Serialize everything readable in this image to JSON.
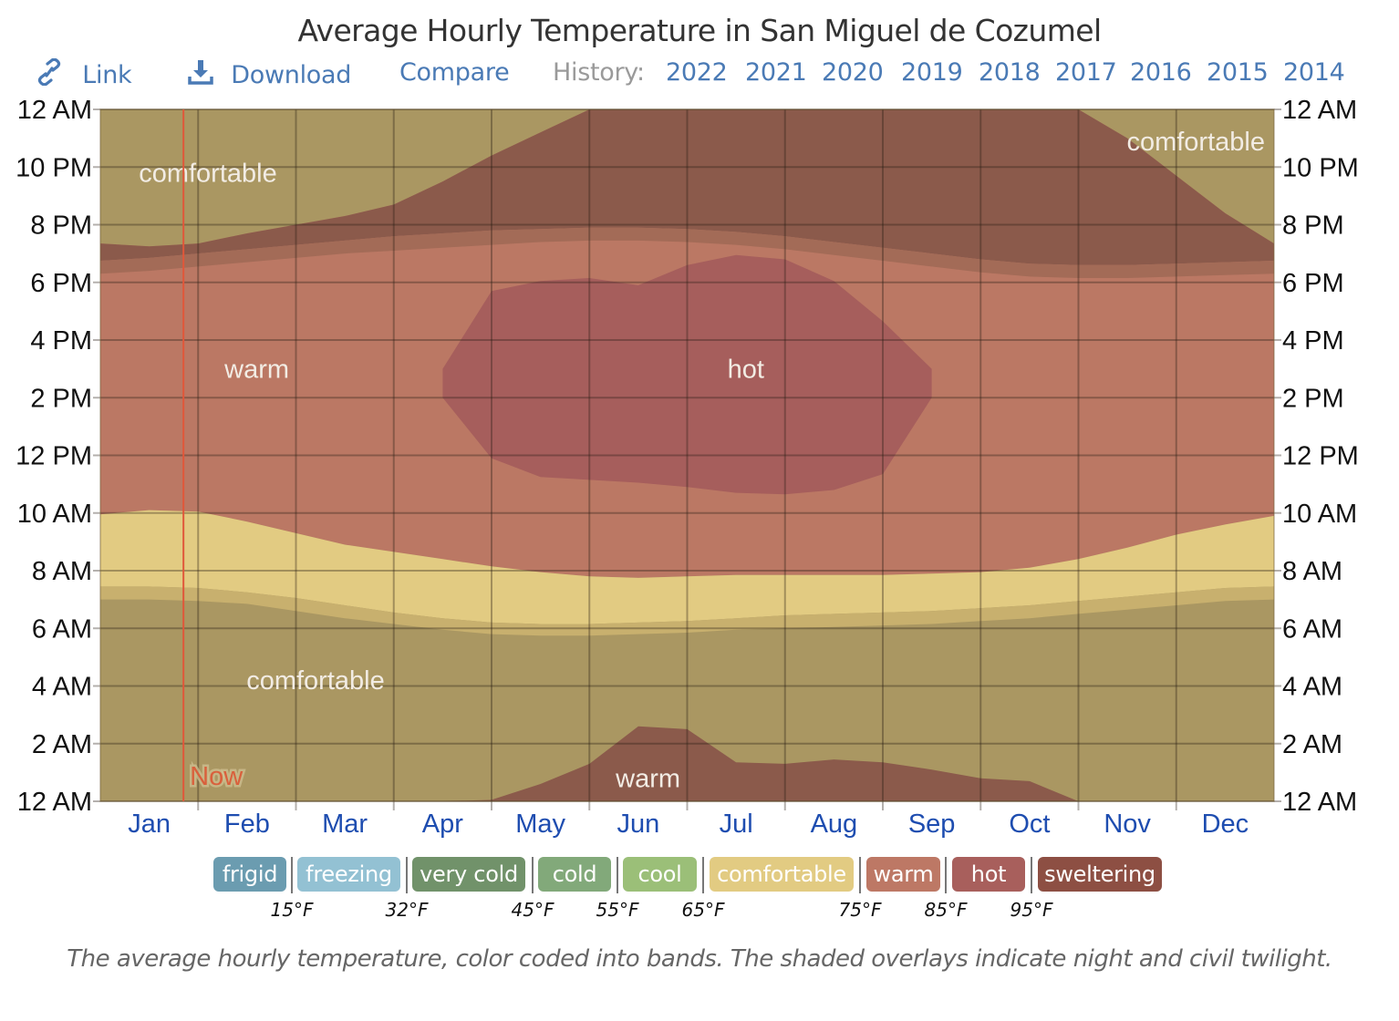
{
  "header": {
    "title": "Average Hourly Temperature in San Miguel de Cozumel"
  },
  "toolbar": {
    "link_label": "Link",
    "link_icon": "link-icon",
    "download_label": "Download",
    "download_icon": "download-icon",
    "compare_label": "Compare",
    "history_label": "History:",
    "history_years": [
      "2022",
      "2021",
      "2020",
      "2019",
      "2018",
      "2017",
      "2016",
      "2015",
      "2014"
    ]
  },
  "legend": {
    "bands": [
      {
        "label": "frigid",
        "color": "#6b9cb0"
      },
      {
        "label": "freezing",
        "color": "#93c1d3"
      },
      {
        "label": "very cold",
        "color": "#71926a"
      },
      {
        "label": "cold",
        "color": "#82a97a"
      },
      {
        "label": "cool",
        "color": "#9bbf78"
      },
      {
        "label": "comfortable",
        "color": "#e2cb82"
      },
      {
        "label": "warm",
        "color": "#bd7865"
      },
      {
        "label": "hot",
        "color": "#a85f5c"
      },
      {
        "label": "sweltering",
        "color": "#8d4f43"
      }
    ],
    "thresholds": [
      "15°F",
      "32°F",
      "45°F",
      "55°F",
      "65°F",
      "75°F",
      "85°F",
      "95°F"
    ]
  },
  "caption": "The average hourly temperature, color coded into bands. The shaded overlays indicate night and civil twilight.",
  "now_label": "Now",
  "chart_data": {
    "type": "heatmap",
    "title": "Average Hourly Temperature in San Miguel de Cozumel",
    "xlabel": "",
    "ylabel": "",
    "x_tick_labels": [
      "Jan",
      "Feb",
      "Mar",
      "Apr",
      "May",
      "Jun",
      "Jul",
      "Aug",
      "Sep",
      "Oct",
      "Nov",
      "Dec"
    ],
    "y_tick_labels": [
      "12 AM",
      "10 PM",
      "8 PM",
      "6 PM",
      "4 PM",
      "2 PM",
      "12 PM",
      "10 AM",
      "8 AM",
      "6 AM",
      "4 AM",
      "2 AM",
      "12 AM"
    ],
    "x_domain_months": [
      0,
      12
    ],
    "y_domain_hours": [
      0,
      24
    ],
    "grid": true,
    "now_month": 0.85,
    "region_colors": {
      "comfortable": "#aa9762",
      "comfortable_day": "#e2cb82",
      "warm": "#bb7864",
      "hot": "#a65e5c",
      "sweltering": "#8b5a4b",
      "twilight_day": "#c8b06e",
      "twilight_evening": "#a36b57"
    },
    "boundaries": {
      "month": [
        0,
        0.5,
        1,
        1.5,
        2,
        2.5,
        3,
        3.5,
        4,
        4.5,
        5,
        5.5,
        6,
        6.5,
        7,
        7.5,
        8,
        8.5,
        9,
        9.5,
        10,
        10.5,
        11,
        11.5,
        12
      ],
      "comfortable_to_warm_morning_hour": [
        9.95,
        10.1,
        10.05,
        9.7,
        9.3,
        8.9,
        8.65,
        8.4,
        8.15,
        7.95,
        7.8,
        7.75,
        7.8,
        7.85,
        7.85,
        7.85,
        7.85,
        7.9,
        7.95,
        8.1,
        8.4,
        8.8,
        9.25,
        9.6,
        9.9
      ],
      "night_end_hour": [
        7.0,
        7.0,
        6.95,
        6.85,
        6.6,
        6.35,
        6.15,
        5.95,
        5.8,
        5.75,
        5.75,
        5.8,
        5.85,
        5.95,
        6.0,
        6.05,
        6.1,
        6.15,
        6.25,
        6.35,
        6.5,
        6.65,
        6.8,
        6.95,
        7.0
      ],
      "dawn_twilight_start_hour": [
        7.45,
        7.45,
        7.4,
        7.25,
        7.05,
        6.8,
        6.55,
        6.35,
        6.2,
        6.15,
        6.15,
        6.2,
        6.25,
        6.35,
        6.45,
        6.5,
        6.55,
        6.6,
        6.7,
        6.8,
        6.95,
        7.1,
        7.25,
        7.4,
        7.45
      ],
      "dusk_twilight_start_hour": [
        18.3,
        18.4,
        18.55,
        18.7,
        18.85,
        19.0,
        19.1,
        19.2,
        19.3,
        19.4,
        19.45,
        19.45,
        19.4,
        19.3,
        19.15,
        18.95,
        18.75,
        18.55,
        18.35,
        18.2,
        18.15,
        18.15,
        18.2,
        18.25,
        18.3
      ],
      "night_start_hour": [
        18.75,
        18.85,
        19.0,
        19.15,
        19.3,
        19.45,
        19.6,
        19.7,
        19.8,
        19.85,
        19.9,
        19.9,
        19.85,
        19.75,
        19.6,
        19.4,
        19.2,
        19.0,
        18.8,
        18.65,
        18.6,
        18.6,
        18.65,
        18.7,
        18.75
      ],
      "warm_to_comfortable_evening_hour": [
        19.35,
        19.25,
        19.35,
        19.7,
        20.0,
        20.3,
        20.7,
        21.5,
        22.4,
        23.2,
        24,
        24,
        24,
        24,
        24,
        24,
        24,
        24,
        24,
        24,
        24,
        23.0,
        21.7,
        20.4,
        19.35
      ],
      "sweltering_night_top_hour": [
        0,
        0,
        0,
        0,
        0,
        0,
        0,
        0,
        0.05,
        0.6,
        1.3,
        2.6,
        2.5,
        1.35,
        1.3,
        1.45,
        1.35,
        1.1,
        0.8,
        0.7,
        0,
        0,
        0,
        0,
        0
      ],
      "hot_top_hour": [
        null,
        null,
        null,
        null,
        null,
        null,
        null,
        15.0,
        17.7,
        18.05,
        18.15,
        17.9,
        18.6,
        18.95,
        18.8,
        18.05,
        16.65,
        15.0,
        null,
        null,
        null,
        null,
        null,
        null,
        null
      ],
      "hot_bottom_hour": [
        null,
        null,
        null,
        null,
        null,
        null,
        null,
        14.0,
        11.9,
        11.25,
        11.15,
        11.05,
        10.9,
        10.7,
        10.65,
        10.8,
        11.35,
        14.0,
        null,
        null,
        null,
        null,
        null,
        null,
        null
      ]
    },
    "region_labels": [
      {
        "text": "comfortable",
        "month": 1.1,
        "hour": 21.8
      },
      {
        "text": "comfortable",
        "month": 11.2,
        "hour": 22.9
      },
      {
        "text": "warm",
        "month": 1.6,
        "hour": 15.0
      },
      {
        "text": "hot",
        "month": 6.6,
        "hour": 15.0
      },
      {
        "text": "comfortable",
        "month": 2.2,
        "hour": 4.2
      },
      {
        "text": "warm",
        "month": 5.6,
        "hour": 0.8
      }
    ]
  }
}
